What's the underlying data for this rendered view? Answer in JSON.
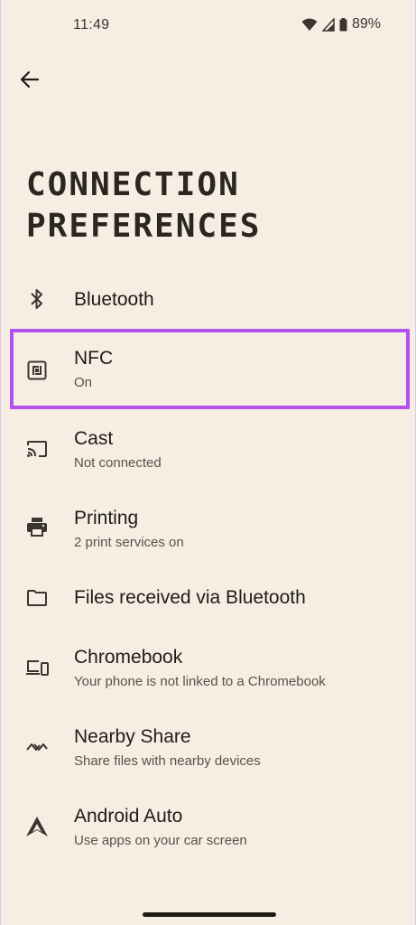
{
  "status": {
    "time": "11:49",
    "battery": "89%",
    "icons": [
      "wifi-icon",
      "signal-icon",
      "battery-icon"
    ]
  },
  "header": {
    "back_icon": "back-arrow-icon",
    "title_line1": "CONNECTION",
    "title_line2": "PREFERENCES"
  },
  "items": [
    {
      "icon": "bluetooth-icon",
      "title": "Bluetooth",
      "subtitle": ""
    },
    {
      "icon": "nfc-icon",
      "title": "NFC",
      "subtitle": "On"
    },
    {
      "icon": "cast-icon",
      "title": "Cast",
      "subtitle": "Not connected"
    },
    {
      "icon": "printer-icon",
      "title": "Printing",
      "subtitle": "2 print services on"
    },
    {
      "icon": "folder-icon",
      "title": "Files received via Bluetooth",
      "subtitle": ""
    },
    {
      "icon": "chromebook-icon",
      "title": "Chromebook",
      "subtitle": "Your phone is not linked to a Chromebook"
    },
    {
      "icon": "nearby-share-icon",
      "title": "Nearby Share",
      "subtitle": "Share files with nearby devices"
    },
    {
      "icon": "android-auto-icon",
      "title": "Android Auto",
      "subtitle": "Use apps on your car screen"
    }
  ],
  "colors": {
    "background": "#f6eee3",
    "highlight": "#b44ff0",
    "text_primary": "#1f1b16",
    "text_secondary": "#5a524a"
  }
}
